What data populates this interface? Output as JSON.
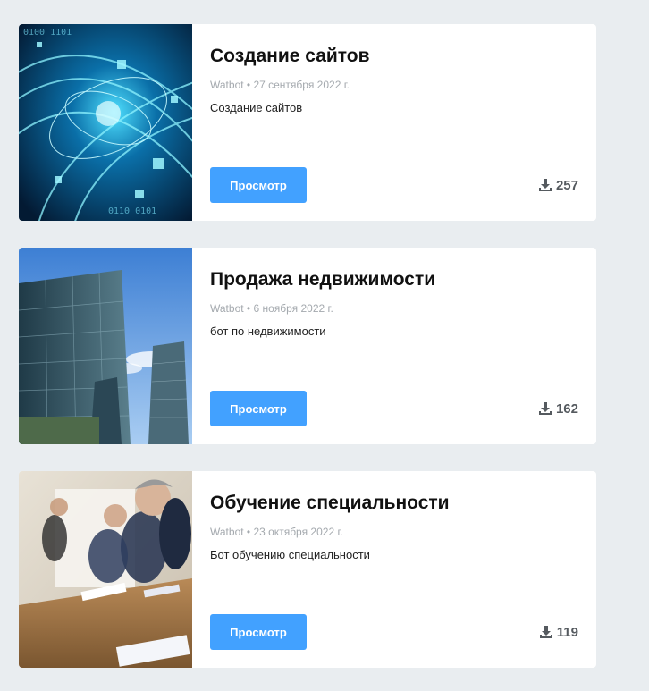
{
  "items": [
    {
      "title": "Создание сайтов",
      "author": "Watbot",
      "date": "27 сентября 2022 г.",
      "description": "Создание сайтов",
      "button_label": "Просмотр",
      "downloads": "257",
      "image_icon": "cyber-network-image"
    },
    {
      "title": "Продажа недвижимости",
      "author": "Watbot",
      "date": "6 ноября 2022 г.",
      "description": "бот по недвижимости",
      "button_label": "Просмотр",
      "downloads": "162",
      "image_icon": "skyscrapers-image"
    },
    {
      "title": "Обучение специальности",
      "author": "Watbot",
      "date": "23 октября 2022 г.",
      "description": "Бот обучению специальности",
      "button_label": "Просмотр",
      "downloads": "119",
      "image_icon": "meeting-room-image"
    }
  ],
  "colors": {
    "background": "#e9edf0",
    "card": "#ffffff",
    "button": "#42a1ff",
    "meta_text": "#a4a9ae"
  }
}
